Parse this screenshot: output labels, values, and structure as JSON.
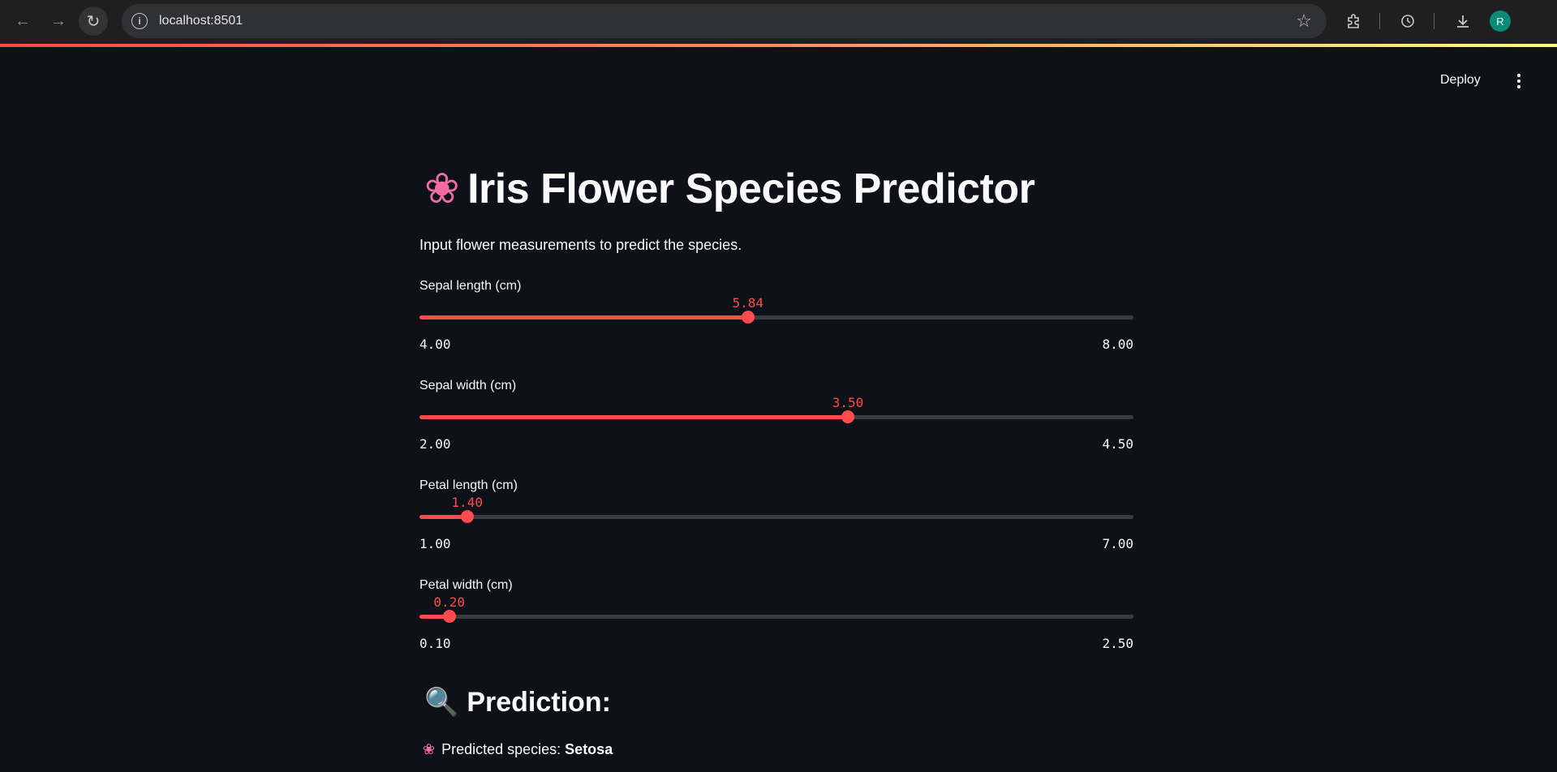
{
  "browser": {
    "url": "localhost:8501",
    "avatar_initial": "R"
  },
  "app": {
    "deploy_label": "Deploy",
    "title": "Iris Flower Species Predictor",
    "title_icon": "cherry-blossom-icon",
    "subtitle": "Input flower measurements to predict the species.",
    "sliders": [
      {
        "label": "Sepal length (cm)",
        "value": "5.84",
        "min": "4.00",
        "max": "8.00",
        "fraction": 0.46
      },
      {
        "label": "Sepal width (cm)",
        "value": "3.50",
        "min": "2.00",
        "max": "4.50",
        "fraction": 0.6
      },
      {
        "label": "Petal length (cm)",
        "value": "1.40",
        "min": "1.00",
        "max": "7.00",
        "fraction": 0.0667
      },
      {
        "label": "Petal width (cm)",
        "value": "0.20",
        "min": "0.10",
        "max": "2.50",
        "fraction": 0.0417
      }
    ],
    "prediction_heading": "Prediction:",
    "prediction_icon": "magnifier-icon",
    "prediction_prefix": "Predicted species: ",
    "prediction_value": "Setosa"
  },
  "colors": {
    "accent": "#ff4b4b",
    "background": "#0e1117",
    "track": "#3a3c44"
  }
}
